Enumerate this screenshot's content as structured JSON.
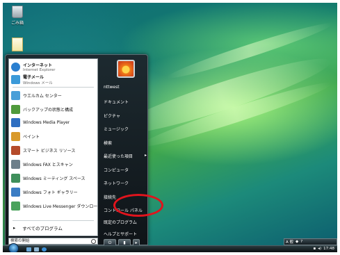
{
  "desktop": {
    "recycle_bin_label": "ごみ箱"
  },
  "start_menu": {
    "pinned": [
      {
        "title": "インターネット",
        "subtitle": "Internet Explorer",
        "icon": "ie-icon",
        "color": "#2a7fd0"
      },
      {
        "title": "電子メール",
        "subtitle": "Windows メール",
        "icon": "mail-icon",
        "color": "#3b9ad9"
      }
    ],
    "recent": [
      {
        "label": "ウエルカム センター",
        "icon": "welcome-center-icon",
        "color": "#4a9fd8"
      },
      {
        "label": "バックアップの状態と構成",
        "icon": "backup-icon",
        "color": "#4f9a3c"
      },
      {
        "label": "Windows Media Player",
        "icon": "media-player-icon",
        "color": "#2f6fc1"
      },
      {
        "label": "ペイント",
        "icon": "paint-icon",
        "color": "#d99a2b"
      },
      {
        "label": "スマート ビジネス リソース",
        "icon": "business-icon",
        "color": "#b54b2a"
      },
      {
        "label": "Windows FAX とスキャン",
        "icon": "fax-icon",
        "color": "#6d7f8a"
      },
      {
        "label": "Windows ミーティング スペース",
        "icon": "meeting-icon",
        "color": "#3f8f5b"
      },
      {
        "label": "Windows フォト ギャラリー",
        "icon": "photo-gallery-icon",
        "color": "#3b7dc4"
      },
      {
        "label": "Windows Live Messenger ダウンロード",
        "icon": "messenger-icon",
        "color": "#4aa35c"
      }
    ],
    "all_programs": "すべてのプログラム",
    "search_placeholder": "検索の開始",
    "right": {
      "user": "nttwest",
      "documents": "ドキュメント",
      "pictures": "ピクチャ",
      "music": "ミュージック",
      "search": "検索",
      "recent_items": "最近使った項目",
      "computer": "コンピュータ",
      "network": "ネットワーク",
      "connect_to": "接続先",
      "control_panel": "コントロール パネル",
      "default_programs": "既定のプログラム",
      "help": "ヘルプとサポート"
    }
  },
  "taskbar": {
    "clock": "17:48",
    "ime": "A 般"
  }
}
